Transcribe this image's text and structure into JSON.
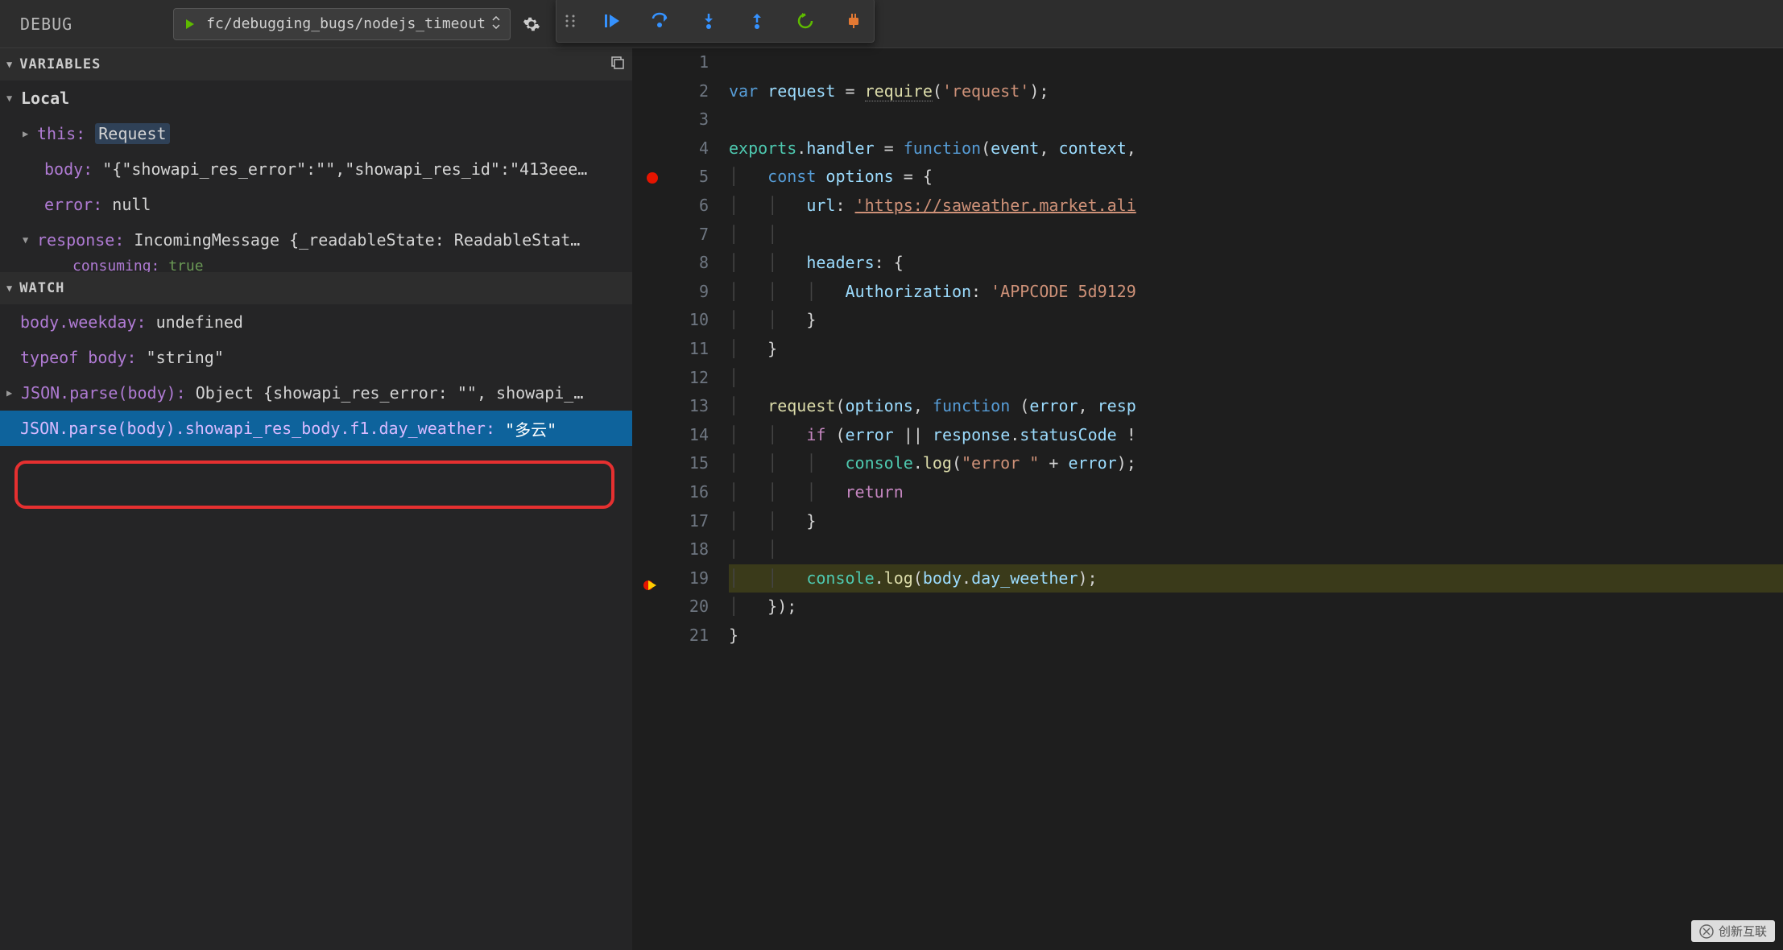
{
  "header": {
    "debug_label": "DEBUG",
    "config_name": "fc/debugging_bugs/nodejs_timeout"
  },
  "sections": {
    "variables_title": "VARIABLES",
    "watch_title": "WATCH"
  },
  "variables": {
    "local_label": "Local",
    "this_key": "this:",
    "this_val": "Request",
    "body_key": "body:",
    "body_val": "\"{\"showapi_res_error\":\"\",\"showapi_res_id\":\"413eee…",
    "error_key": "error:",
    "error_val": "null",
    "response_key": "response:",
    "response_val": "IncomingMessage {_readableState: ReadableStat…",
    "consuming_key": "consuming:",
    "consuming_val": "true"
  },
  "watch": {
    "w1_expr": "body.weekday:",
    "w1_val": "undefined",
    "w2_expr": "typeof body:",
    "w2_val": "\"string\"",
    "w3_expr": "JSON.parse(body):",
    "w3_val": "Object {showapi_res_error: \"\", showapi_…",
    "w4_expr": "JSON.parse(body).showapi_res_body.f1.day_weather:",
    "w4_val": "\"多云\""
  },
  "code": {
    "lines": {
      "1": "",
      "2_var": "var",
      "2_req": "request",
      "2_eq": " = ",
      "2_fn": "require",
      "2_open": "(",
      "2_str": "'request'",
      "2_close": ");",
      "3": "",
      "4_exp": "exports",
      "4_dot": ".",
      "4_hand": "handler",
      "4_eq": " = ",
      "4_fn": "function",
      "4_open": "(",
      "4_ev": "event",
      "4_c": ", ",
      "4_ctx": "context",
      "4_cc": ",",
      "5_const": "const",
      "5_opt": " options",
      "5_eq": " = {",
      "6_url": "url",
      "6_col": ": ",
      "6_val": "'https://saweather.market.ali",
      "7": "",
      "8_hd": "headers",
      "8_col": ": {",
      "9_auth": "Authorization",
      "9_col": ": ",
      "9_val": "'APPCODE 5d9129",
      "10": "}",
      "11": "}",
      "12": "",
      "13_fn": "request",
      "13_open": "(",
      "13_opt": "options",
      "13_c": ", ",
      "13_func": "function",
      "13_o2": " (",
      "13_err": "error",
      "13_c2": ", ",
      "13_resp": "resp",
      "14_if": "if",
      "14_open": " (",
      "14_err": "error",
      "14_or": " || ",
      "14_resp": "response",
      "14_dot": ".",
      "14_sc": "statusCode",
      "14_ne": " !",
      "15_con": "console",
      "15_dot": ".",
      "15_log": "log",
      "15_open": "(",
      "15_str": "\"error \"",
      "15_plus": " + ",
      "15_err": "error",
      "15_close": ");",
      "16_ret": "return",
      "17": "}",
      "18": "",
      "19_con": "console",
      "19_dot": ".",
      "19_log": "log",
      "19_open": "(",
      "19_body": "body",
      "19_d2": ".",
      "19_dw": "day_weether",
      "19_close": ");",
      "20": "});",
      "21": "}"
    }
  },
  "line_numbers": [
    "1",
    "2",
    "3",
    "4",
    "5",
    "6",
    "7",
    "8",
    "9",
    "10",
    "11",
    "12",
    "13",
    "14",
    "15",
    "16",
    "17",
    "18",
    "19",
    "20",
    "21"
  ],
  "watermark": "创新互联"
}
